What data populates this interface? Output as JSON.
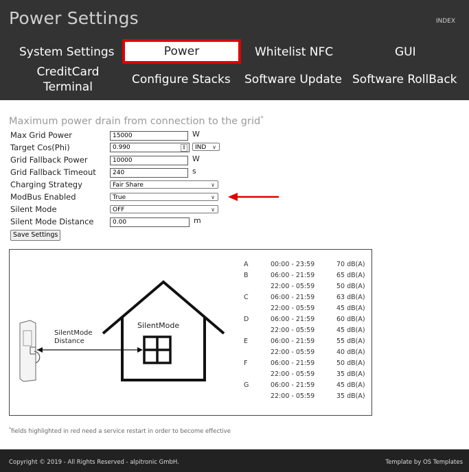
{
  "header": {
    "title": "Power Settings",
    "index_link": "INDEX",
    "nav": [
      {
        "label": "System Settings",
        "active": false
      },
      {
        "label": "Power",
        "active": true
      },
      {
        "label": "Whitelist NFC",
        "active": false
      },
      {
        "label": "GUI",
        "active": false
      },
      {
        "label": "CreditCard Terminal",
        "active": false
      },
      {
        "label": "Configure Stacks",
        "active": false
      },
      {
        "label": "Software Update",
        "active": false
      },
      {
        "label": "Software RollBack",
        "active": false
      }
    ]
  },
  "form": {
    "heading": "Maximum power drain from connection to the grid",
    "heading_mark": "*",
    "max_grid_power": {
      "label": "Max Grid Power",
      "value": "15000",
      "unit": "W"
    },
    "target_cosphi": {
      "label": "Target Cos(Phi)",
      "value": "0.990",
      "mode": "IND"
    },
    "grid_fallback_power": {
      "label": "Grid Fallback Power",
      "value": "10000",
      "unit": "W"
    },
    "grid_fallback_timeout": {
      "label": "Grid Fallback Timeout",
      "value": "240",
      "unit": "s"
    },
    "charging_strategy": {
      "label": "Charging Strategy",
      "value": "Fair Share"
    },
    "modbus_enabled": {
      "label": "ModBus Enabled",
      "value": "True"
    },
    "silent_mode": {
      "label": "Silent Mode",
      "value": "OFF"
    },
    "silent_mode_distance": {
      "label": "Silent Mode Distance",
      "value": "0.00",
      "unit": "m"
    },
    "save_label": "Save Settings"
  },
  "diagram": {
    "charger_label_line1": "SilentMode",
    "charger_label_line2": "Distance",
    "house_label": "SilentMode",
    "rows": [
      {
        "level": "A",
        "time": "00:00 - 23:59",
        "db": "70 dB(A)"
      },
      {
        "level": "B",
        "time": "06:00 - 21:59",
        "db": "65 dB(A)"
      },
      {
        "level": "",
        "time": "22:00 - 05:59",
        "db": "50 dB(A)"
      },
      {
        "level": "C",
        "time": "06:00 - 21:59",
        "db": "63 dB(A)"
      },
      {
        "level": "",
        "time": "22:00 - 05:59",
        "db": "45 dB(A)"
      },
      {
        "level": "D",
        "time": "06:00 - 21:59",
        "db": "60 dB(A)"
      },
      {
        "level": "",
        "time": "22:00 - 05:59",
        "db": "45 dB(A)"
      },
      {
        "level": "E",
        "time": "06:00 - 21:59",
        "db": "55 dB(A)"
      },
      {
        "level": "",
        "time": "22:00 - 05:59",
        "db": "40 dB(A)"
      },
      {
        "level": "F",
        "time": "06:00 - 21:59",
        "db": "50 dB(A)"
      },
      {
        "level": "",
        "time": "22:00 - 05:59",
        "db": "35 dB(A)"
      },
      {
        "level": "G",
        "time": "06:00 - 21:59",
        "db": "45 dB(A)"
      },
      {
        "level": "",
        "time": "22:00 - 05:59",
        "db": "35 dB(A)"
      }
    ]
  },
  "footnote": {
    "mark": "*",
    "text": "fields highlighted in red need a service restart in order to become effective"
  },
  "footer": {
    "copyright": "Copyright © 2019 - All Rights Reserved - alpitronic GmbH.",
    "template_credit": "Template by OS Templates"
  },
  "colors": {
    "header_bg": "#333333",
    "footer_bg": "#222222",
    "active_border": "#e00000",
    "arrow": "#e00000"
  }
}
